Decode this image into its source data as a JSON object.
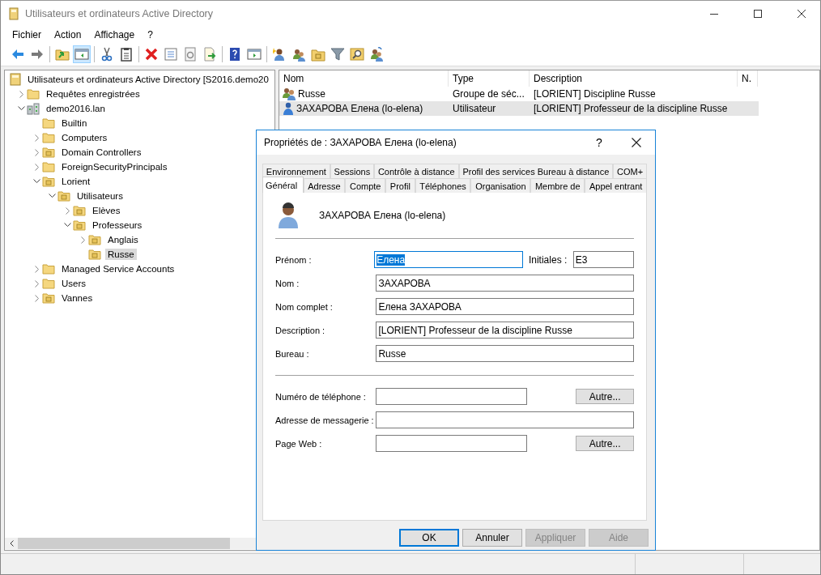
{
  "window": {
    "title": "Utilisateurs et ordinateurs Active Directory"
  },
  "menu": [
    "Fichier",
    "Action",
    "Affichage",
    "?"
  ],
  "toolbar": [
    {
      "tools": [
        {
          "kind": "back",
          "pressed": false
        },
        {
          "kind": "forward",
          "pressed": false
        }
      ]
    },
    {
      "tools": [
        {
          "kind": "up",
          "pressed": false
        },
        {
          "kind": "tree-pane",
          "pressed": true
        }
      ]
    },
    {
      "tools": [
        {
          "kind": "cut",
          "pressed": false
        },
        {
          "kind": "paste",
          "pressed": false
        }
      ]
    },
    {
      "tools": [
        {
          "kind": "delete",
          "pressed": false
        },
        {
          "kind": "properties",
          "pressed": false
        },
        {
          "kind": "refresh",
          "pressed": false
        },
        {
          "kind": "export",
          "pressed": false
        }
      ]
    },
    {
      "tools": [
        {
          "kind": "help",
          "pressed": false
        },
        {
          "kind": "action-pane",
          "pressed": false
        }
      ]
    },
    {
      "tools": [
        {
          "kind": "new-user",
          "pressed": false
        },
        {
          "kind": "new-group",
          "pressed": false
        },
        {
          "kind": "new-ou",
          "pressed": false
        },
        {
          "kind": "filter",
          "pressed": false
        },
        {
          "kind": "find",
          "pressed": false
        },
        {
          "kind": "move",
          "pressed": false
        }
      ]
    }
  ],
  "tree": {
    "label": "Utilisateurs et ordinateurs Active Directory [S2016.demo20",
    "kind": "root",
    "selected": false,
    "children": [
      {
        "label": "Requêtes enregistrées",
        "kind": "folder",
        "expanded": false,
        "selected": false
      },
      {
        "label": "demo2016.lan",
        "kind": "domain",
        "expanded": true,
        "selected": false,
        "children": [
          {
            "label": "Builtin",
            "kind": "folder",
            "selected": false
          },
          {
            "label": "Computers",
            "kind": "folder",
            "expanded": false,
            "selected": false
          },
          {
            "label": "Domain Controllers",
            "kind": "ou",
            "expanded": false,
            "selected": false
          },
          {
            "label": "ForeignSecurityPrincipals",
            "kind": "folder",
            "expanded": false,
            "selected": false
          },
          {
            "label": "Lorient",
            "kind": "ou",
            "expanded": true,
            "selected": false,
            "children": [
              {
                "label": "Utilisateurs",
                "kind": "ou",
                "expanded": true,
                "selected": false,
                "children": [
                  {
                    "label": "Elèves",
                    "kind": "ou",
                    "expanded": false,
                    "selected": false
                  },
                  {
                    "label": "Professeurs",
                    "kind": "ou",
                    "expanded": true,
                    "selected": false,
                    "children": [
                      {
                        "label": "Anglais",
                        "kind": "ou",
                        "expanded": false,
                        "selected": false
                      },
                      {
                        "label": "Russe",
                        "kind": "ou",
                        "selected": true
                      }
                    ]
                  }
                ]
              }
            ]
          },
          {
            "label": "Managed Service Accounts",
            "kind": "folder",
            "expanded": false,
            "selected": false
          },
          {
            "label": "Users",
            "kind": "folder",
            "expanded": false,
            "selected": false
          },
          {
            "label": "Vannes",
            "kind": "ou",
            "expanded": false,
            "selected": false
          }
        ]
      }
    ]
  },
  "list": {
    "columns": [
      "Nom",
      "Type",
      "Description",
      "N."
    ],
    "rows": [
      {
        "kind": "group",
        "selected": false,
        "cells": [
          "Russe",
          "Groupe de séc...",
          "[LORIENT] Discipline Russe"
        ]
      },
      {
        "kind": "user",
        "selected": true,
        "cells": [
          "ЗАХАРОВА Елена (lo-elena)",
          "Utilisateur",
          "[LORIENT] Professeur de la discipline Russe"
        ]
      }
    ]
  },
  "dialog": {
    "title": "Propriétés de : ЗАХАРОВА Елена (lo-elena)",
    "help": "?",
    "tab_rows": [
      [
        {
          "label": "Environnement",
          "selected": false
        },
        {
          "label": "Sessions",
          "selected": false
        },
        {
          "label": "Contrôle à distance",
          "selected": false
        },
        {
          "label": "Profil des services Bureau à distance",
          "selected": false
        },
        {
          "label": "COM+",
          "selected": false
        }
      ],
      [
        {
          "label": "Général",
          "selected": true
        },
        {
          "label": "Adresse",
          "selected": false
        },
        {
          "label": "Compte",
          "selected": false
        },
        {
          "label": "Profil",
          "selected": false
        },
        {
          "label": "Téléphones",
          "selected": false
        },
        {
          "label": "Organisation",
          "selected": false
        },
        {
          "label": "Membre de",
          "selected": false
        },
        {
          "label": "Appel entrant",
          "selected": false
        }
      ]
    ],
    "user_name": "ЗАХАРОВА Елена (lo-elena)",
    "identity_fields": [
      {
        "label": "Prénom :",
        "value": "Елена",
        "text_selected": true,
        "side": {
          "label": "Initiales :",
          "value": "E3"
        }
      },
      {
        "label": "Nom :",
        "value": "ЗАХАРОВА",
        "text_selected": false
      },
      {
        "label": "Nom complet :",
        "value": "Елена ЗАХАРОВА",
        "text_selected": false
      },
      {
        "label": "Description :",
        "value": "[LORIENT] Professeur de la discipline Russe",
        "text_selected": false
      },
      {
        "label": "Bureau :",
        "value": "Russe",
        "text_selected": false
      }
    ],
    "contact_fields": [
      {
        "label": "Numéro de téléphone :",
        "button": "Autre..."
      },
      {
        "label": "Adresse de messagerie :"
      },
      {
        "label": "Page Web :",
        "button": "Autre..."
      }
    ],
    "buttons": [
      {
        "label": "OK",
        "default": true,
        "disabled": false
      },
      {
        "label": "Annuler",
        "default": false,
        "disabled": false
      },
      {
        "label": "Appliquer",
        "default": false,
        "disabled": true
      },
      {
        "label": "Aide",
        "default": false,
        "disabled": true
      }
    ]
  }
}
